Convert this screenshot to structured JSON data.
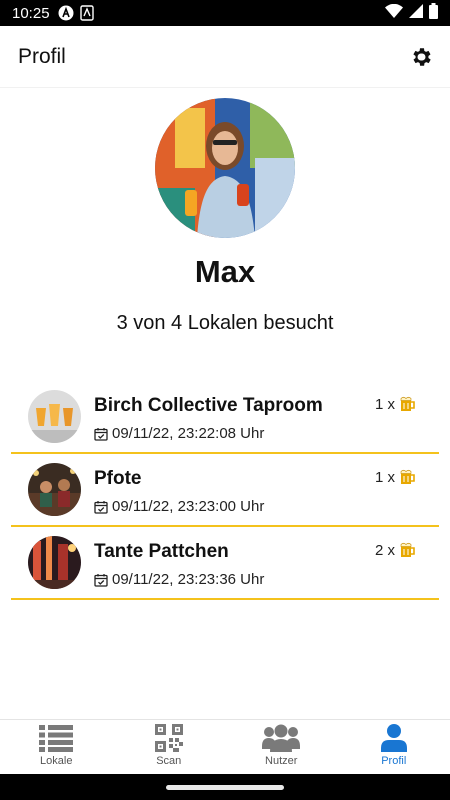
{
  "statusbar": {
    "time": "10:25"
  },
  "header": {
    "title": "Profil"
  },
  "profile": {
    "name": "Max",
    "visited": "3 von 4 Lokalen besucht"
  },
  "visits": [
    {
      "name": "Birch Collective Taproom",
      "date": "09/11/22, 23:22:08 Uhr",
      "count": "1 x"
    },
    {
      "name": "Pfote",
      "date": "09/11/22, 23:23:00 Uhr",
      "count": "1 x"
    },
    {
      "name": "Tante Pattchen",
      "date": "09/11/22, 23:23:36 Uhr",
      "count": "2 x"
    }
  ],
  "nav": [
    {
      "label": "Lokale",
      "icon": "list-icon"
    },
    {
      "label": "Scan",
      "icon": "qr-code-icon"
    },
    {
      "label": "Nutzer",
      "icon": "users-icon"
    },
    {
      "label": "Profil",
      "icon": "person-icon",
      "active": true
    }
  ],
  "colors": {
    "accent": "#1976d2",
    "divider": "#f4c21c",
    "beer": "#e8a800",
    "nav_icon": "#7a7a7a"
  }
}
